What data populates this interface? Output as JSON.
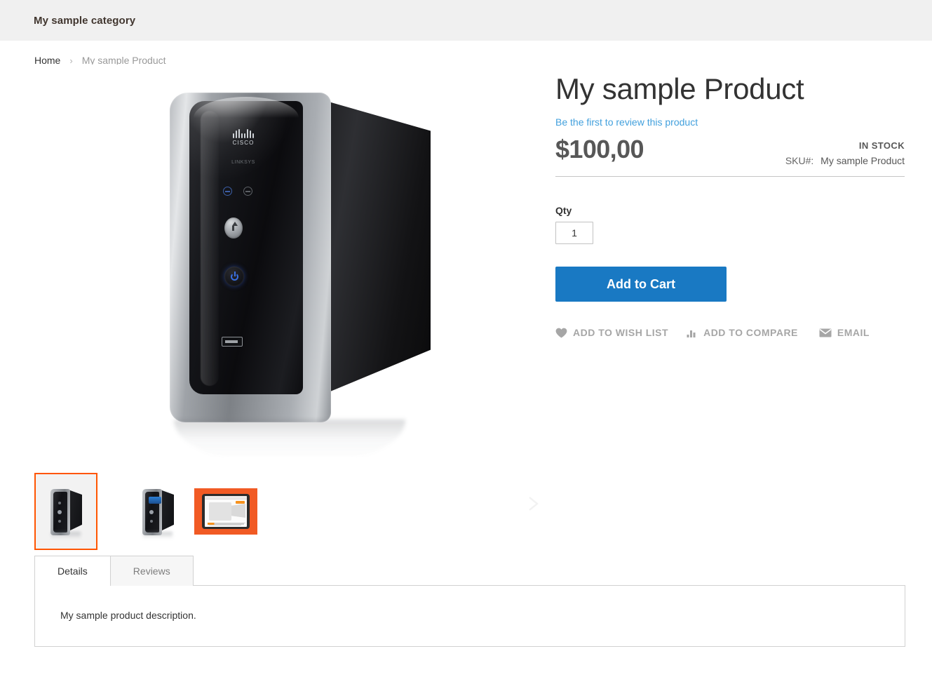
{
  "header": {
    "category_title": "My sample category"
  },
  "breadcrumbs": {
    "home_label": "Home",
    "separator": "›",
    "current_label": "My sample Product"
  },
  "gallery": {
    "next_arrow_icon": "chevron-right-icon",
    "thumbnails": [
      {
        "name": "thumbnail-1-nas-front",
        "selected": true,
        "border_color": "#ff5501"
      },
      {
        "name": "thumbnail-2-nas-lcd",
        "selected": false
      },
      {
        "name": "thumbnail-3-tablet-screenshot",
        "selected": false,
        "background_color": "#f15a24"
      }
    ],
    "main_image_alt": "Cisco Linksys network storage device"
  },
  "product": {
    "name": "My sample Product",
    "review_link_label": "Be the first to review this product",
    "price": "$100,00",
    "stock_status": "IN STOCK",
    "sku_label": "SKU#:",
    "sku_value": "My sample Product",
    "qty_label": "Qty",
    "qty_value": "1",
    "qty_placeholder": "1",
    "add_to_cart_label": "Add to Cart",
    "social": [
      {
        "icon": "heart-icon",
        "label": "Add to Wish List"
      },
      {
        "icon": "bar-chart-icon",
        "label": "Add to Compare"
      },
      {
        "icon": "envelope-icon",
        "label": "Email"
      }
    ]
  },
  "tabs": {
    "items": [
      {
        "label": "Details",
        "active": true
      },
      {
        "label": "Reviews",
        "active": false
      }
    ],
    "details_content": "My sample product description."
  },
  "colors": {
    "accent_orange": "#ff5501",
    "primary_blue": "#1979c3",
    "link_blue": "#42a0dd",
    "header_bar_bg": "#f0f0f0",
    "price_text": "#575757",
    "muted_text": "#a6a6a6",
    "border_gray": "#d1d1d1"
  }
}
